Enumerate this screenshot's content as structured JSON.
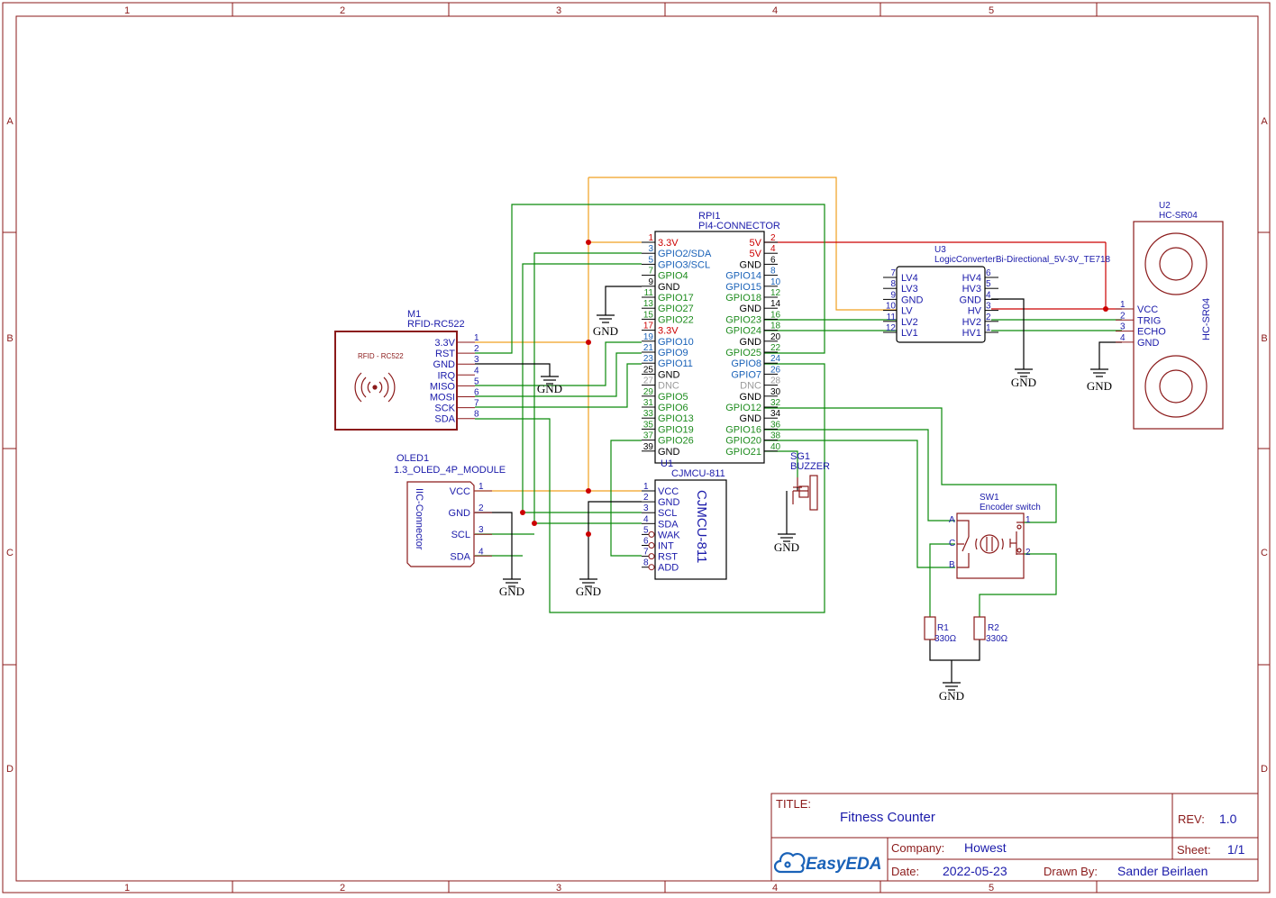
{
  "frame": {
    "columns": [
      "1",
      "2",
      "3",
      "4",
      "5"
    ],
    "rows": [
      "A",
      "B",
      "C",
      "D"
    ]
  },
  "title_block": {
    "title_label": "TITLE:",
    "title": "Fitness Counter",
    "rev_label": "REV:",
    "rev": "1.0",
    "company_label": "Company:",
    "company": "Howest",
    "sheet_label": "Sheet:",
    "sheet": "1/1",
    "date_label": "Date:",
    "date": "2022-05-23",
    "drawn_label": "Drawn By:",
    "drawn_by": "Sander Beirlaen",
    "logo": "EasyEDA"
  },
  "net_labels": {
    "gnd": "GND"
  },
  "rpi": {
    "ref": "RPI1",
    "value": "PI4-CONNECTOR",
    "pins": [
      {
        "l": "3.3V",
        "ln": "1",
        "lc": "#cc0000",
        "r": "5V",
        "rn": "2",
        "rc": "#cc0000"
      },
      {
        "l": "GPIO2/SDA",
        "ln": "3",
        "lc": "#1a62b8",
        "r": "5V",
        "rn": "4",
        "rc": "#cc0000"
      },
      {
        "l": "GPIO3/SCL",
        "ln": "5",
        "lc": "#1a62b8",
        "r": "GND",
        "rn": "6",
        "rc": "#000000"
      },
      {
        "l": "GPIO4",
        "ln": "7",
        "lc": "#1e8c1e",
        "r": "GPIO14",
        "rn": "8",
        "rc": "#1a62b8"
      },
      {
        "l": "GND",
        "ln": "9",
        "lc": "#000000",
        "r": "GPIO15",
        "rn": "10",
        "rc": "#1a62b8"
      },
      {
        "l": "GPIO17",
        "ln": "11",
        "lc": "#1e8c1e",
        "r": "GPIO18",
        "rn": "12",
        "rc": "#1e8c1e"
      },
      {
        "l": "GPIO27",
        "ln": "13",
        "lc": "#1e8c1e",
        "r": "GND",
        "rn": "14",
        "rc": "#000000"
      },
      {
        "l": "GPIO22",
        "ln": "15",
        "lc": "#1e8c1e",
        "r": "GPIO23",
        "rn": "16",
        "rc": "#1e8c1e"
      },
      {
        "l": "3.3V",
        "ln": "17",
        "lc": "#cc0000",
        "r": "GPIO24",
        "rn": "18",
        "rc": "#1e8c1e"
      },
      {
        "l": "GPIO10",
        "ln": "19",
        "lc": "#1a62b8",
        "r": "GND",
        "rn": "20",
        "rc": "#000000"
      },
      {
        "l": "GPIO9",
        "ln": "21",
        "lc": "#1a62b8",
        "r": "GPIO25",
        "rn": "22",
        "rc": "#1e8c1e"
      },
      {
        "l": "GPIO11",
        "ln": "23",
        "lc": "#1a62b8",
        "r": "GPIO8",
        "rn": "24",
        "rc": "#1a62b8"
      },
      {
        "l": "GND",
        "ln": "25",
        "lc": "#000000",
        "r": "GPIO7",
        "rn": "26",
        "rc": "#1a62b8"
      },
      {
        "l": "DNC",
        "ln": "27",
        "lc": "#9a9a9a",
        "r": "DNC",
        "rn": "28",
        "rc": "#9a9a9a"
      },
      {
        "l": "GPIO5",
        "ln": "29",
        "lc": "#1e8c1e",
        "r": "GND",
        "rn": "30",
        "rc": "#000000"
      },
      {
        "l": "GPIO6",
        "ln": "31",
        "lc": "#1e8c1e",
        "r": "GPIO12",
        "rn": "32",
        "rc": "#1e8c1e"
      },
      {
        "l": "GPIO13",
        "ln": "33",
        "lc": "#1e8c1e",
        "r": "GND",
        "rn": "34",
        "rc": "#000000"
      },
      {
        "l": "GPIO19",
        "ln": "35",
        "lc": "#1e8c1e",
        "r": "GPIO16",
        "rn": "36",
        "rc": "#1e8c1e"
      },
      {
        "l": "GPIO26",
        "ln": "37",
        "lc": "#1e8c1e",
        "r": "GPIO20",
        "rn": "38",
        "rc": "#1e8c1e"
      },
      {
        "l": "GND",
        "ln": "39",
        "lc": "#000000",
        "r": "GPIO21",
        "rn": "40",
        "rc": "#1e8c1e"
      }
    ]
  },
  "rfid": {
    "ref": "M1",
    "value": "RFID-RC522",
    "body_label": "RFID - RC522",
    "icon": "rfid-waves-icon",
    "pins": [
      {
        "n": "1",
        "name": "3.3V"
      },
      {
        "n": "2",
        "name": "RST"
      },
      {
        "n": "3",
        "name": "GND"
      },
      {
        "n": "4",
        "name": "IRQ"
      },
      {
        "n": "5",
        "name": "MISO"
      },
      {
        "n": "6",
        "name": "MOSI"
      },
      {
        "n": "7",
        "name": "SCK"
      },
      {
        "n": "8",
        "name": "SDA"
      }
    ]
  },
  "oled": {
    "ref": "OLED1",
    "value": "1.3_OLED_4P_MODULE",
    "body_label": "IIC-Connector",
    "pins": [
      {
        "n": "1",
        "name": "VCC"
      },
      {
        "n": "2",
        "name": "GND"
      },
      {
        "n": "3",
        "name": "SCL"
      },
      {
        "n": "4",
        "name": "SDA"
      }
    ]
  },
  "cjmcu": {
    "ref": "U1",
    "value": "CJMCU-811",
    "body_label": "CJMCU-811",
    "pins": [
      {
        "n": "1",
        "name": "VCC"
      },
      {
        "n": "2",
        "name": "GND"
      },
      {
        "n": "3",
        "name": "SCL"
      },
      {
        "n": "4",
        "name": "SDA"
      },
      {
        "n": "5",
        "name": "WAK"
      },
      {
        "n": "6",
        "name": "INT"
      },
      {
        "n": "7",
        "name": "RST"
      },
      {
        "n": "8",
        "name": "ADD"
      }
    ]
  },
  "logic": {
    "ref": "U3",
    "value": "LogicConverterBi-Directional_5V-3V_TE718",
    "left": [
      {
        "n": "7",
        "name": "LV4"
      },
      {
        "n": "8",
        "name": "LV3"
      },
      {
        "n": "9",
        "name": "GND"
      },
      {
        "n": "10",
        "name": "LV"
      },
      {
        "n": "11",
        "name": "LV2"
      },
      {
        "n": "12",
        "name": "LV1"
      }
    ],
    "right": [
      {
        "n": "6",
        "name": "HV4"
      },
      {
        "n": "5",
        "name": "HV3"
      },
      {
        "n": "4",
        "name": "GND"
      },
      {
        "n": "3",
        "name": "HV"
      },
      {
        "n": "2",
        "name": "HV2"
      },
      {
        "n": "1",
        "name": "HV1"
      }
    ]
  },
  "hcsr": {
    "ref": "U2",
    "value": "HC-SR04",
    "body_label": "HC-SR04",
    "pins": [
      {
        "n": "1",
        "name": "VCC"
      },
      {
        "n": "2",
        "name": "TRIG"
      },
      {
        "n": "3",
        "name": "ECHO"
      },
      {
        "n": "4",
        "name": "GND"
      }
    ]
  },
  "buzzer": {
    "ref": "SG1",
    "value": "BUZZER"
  },
  "encoder": {
    "ref": "SW1",
    "value": "Encoder switch",
    "pins": [
      {
        "n": "A"
      },
      {
        "n": "C"
      },
      {
        "n": "B"
      },
      {
        "n": "1"
      },
      {
        "n": "2"
      }
    ]
  },
  "resistors": [
    {
      "ref": "R1",
      "value": "330Ω"
    },
    {
      "ref": "R2",
      "value": "330Ω"
    }
  ],
  "colors": {
    "frame": "#8b1a1a",
    "wire_green": "#0a8a0a",
    "wire_orange": "#f0a020",
    "wire_red": "#cc0000",
    "wire_black": "#000000",
    "text_blue": "#1a1aaa",
    "pin_red": "#8b1a1a",
    "junction": "#cc0000"
  }
}
